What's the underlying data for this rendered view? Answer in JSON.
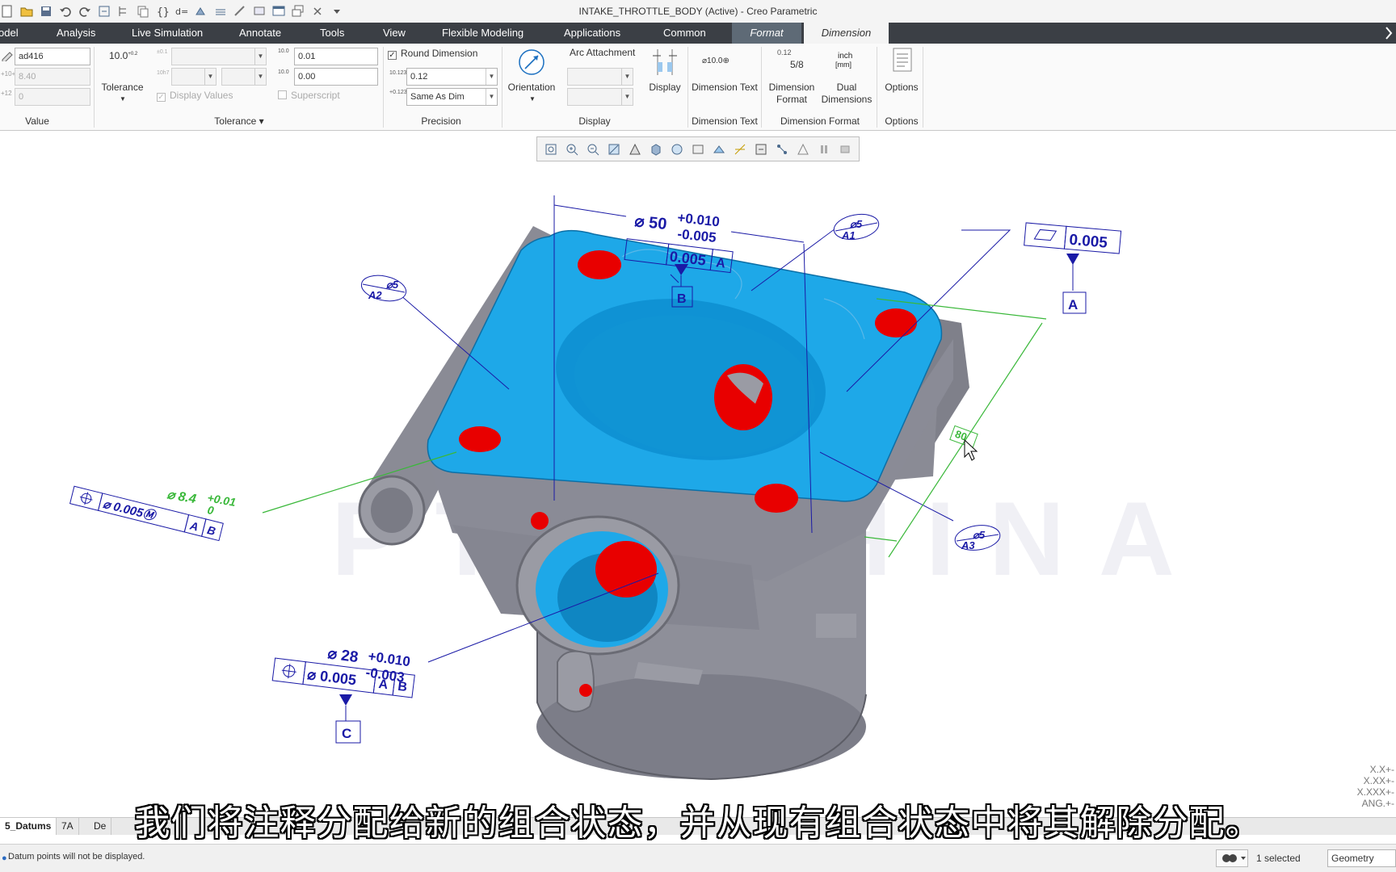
{
  "window": {
    "title": "INTAKE_THROTTLE_BODY (Active) - Creo Parametric"
  },
  "menu": {
    "tabs": [
      "odel",
      "Analysis",
      "Live Simulation",
      "Annotate",
      "Tools",
      "View",
      "Flexible Modeling",
      "Applications",
      "Common",
      "Format",
      "Dimension"
    ],
    "active_tab": "Dimension"
  },
  "ribbon": {
    "value": {
      "name_field": "ad416",
      "value_field": "8.40",
      "offset_field": "0",
      "tolerance_button": "Tolerance",
      "tolerance_icon_text": "10.0",
      "group_label": "Value"
    },
    "tolerance": {
      "upper_field": "0.01",
      "lower_field": "0.00",
      "display_values": "Display Values",
      "superscript": "Superscript",
      "group_label": "Tolerance"
    },
    "precision": {
      "round_dimension": "Round Dimension",
      "precision_value": "0.12",
      "tol_precision_value": "Same As Dim",
      "group_label": "Precision"
    },
    "display": {
      "orientation": "Orientation",
      "arc_attachment": "Arc Attachment",
      "display_btn": "Display",
      "group_label": "Display"
    },
    "dimension_text": {
      "button": "Dimension Text",
      "icon_text": "⌀10.0⊕",
      "group_label": "Dimension Text"
    },
    "dimension_format": {
      "format_button": "Dimension Format",
      "format_icon": "0.12",
      "format_fraction": "5/8",
      "dual_button": "Dual Dimensions",
      "dual_icon_top": "inch",
      "dual_icon_bottom": "[mm]",
      "group_label": "Dimension Format"
    },
    "options": {
      "button": "Options",
      "group_label": "Options"
    }
  },
  "annotations": {
    "dim_top": "⌀ 50",
    "dim_top_upper": "+0.010",
    "dim_top_lower": "-0.005",
    "fcf_top_value": "0.005",
    "fcf_top_datum": "A",
    "datum_b": "B",
    "flatness_value": "0.005",
    "datum_a": "A",
    "target_a1_top": "⌀5",
    "target_a1_bot": "A1",
    "target_a2_top": "⌀5",
    "target_a2_bot": "A2",
    "target_a3_top": "⌀5",
    "target_a3_bot": "A3",
    "dim_80": "80",
    "dim_left": "⌀ 8.4",
    "dim_left_upper": "+0.01",
    "dim_left_lower": "0",
    "fcf_left_value": "⌀ 0.005Ⓜ",
    "fcf_left_a": "A",
    "fcf_left_b": "B",
    "dim_bottom": "⌀ 28",
    "dim_bottom_upper": "+0.010",
    "dim_bottom_lower": "-0.003",
    "fcf_bottom_value": "⌀ 0.005",
    "fcf_bottom_a": "A",
    "fcf_bottom_b": "B",
    "datum_c": "C",
    "watermark": "PTC CHINA"
  },
  "subtitle": "我们将注释分配给新的组合状态，并从现有组合状态中将其解除分配。",
  "dim_formats": [
    "X.X+-",
    "X.XX+-",
    "X.XXX+-",
    "ANG.+-"
  ],
  "bottom_tabs": [
    "5_Datums",
    "7A",
    "De"
  ],
  "status": {
    "message": "Datum points will not be displayed.",
    "selected": "1 selected",
    "filter": "Geometry"
  },
  "colors": {
    "menubar": "#3b3f45",
    "model_top": "#1ea8e8",
    "model_body": "#8c8d96",
    "holes": "#e80000",
    "annotation": "#1a1aa6",
    "selected_dim": "#3ab83a"
  }
}
